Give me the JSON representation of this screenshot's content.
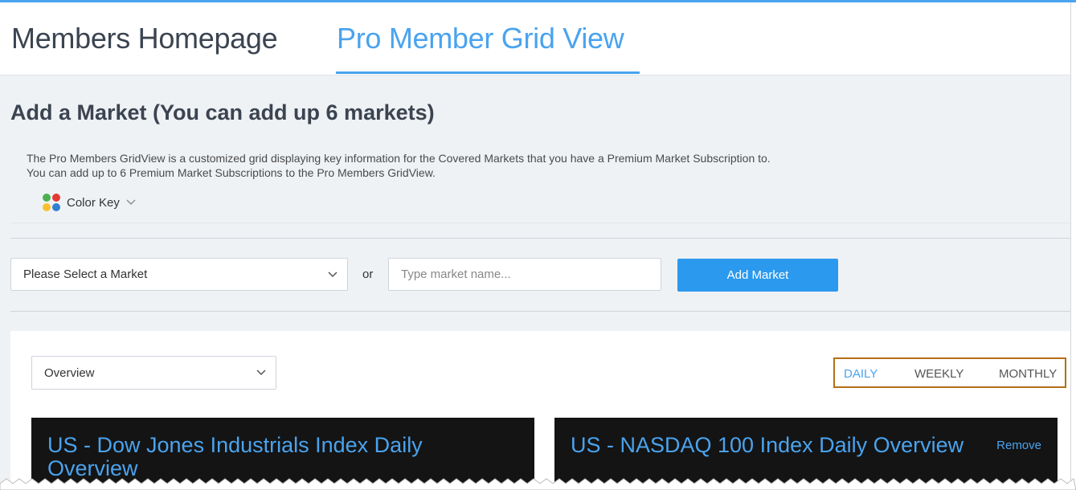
{
  "header": {
    "tabs": [
      {
        "label": "Members Homepage",
        "active": false
      },
      {
        "label": "Pro Member Grid View",
        "active": true
      }
    ]
  },
  "add_market": {
    "title": "Add a Market (You can add up 6 markets)",
    "description_line1": "The Pro Members GridView is a customized grid displaying key information for the Covered Markets that you have a Premium Market Subscription to.",
    "description_line2": "You can add up to 6 Premium Market Subscriptions to the Pro Members GridView.",
    "color_key_label": "Color Key",
    "market_select": {
      "selected": "Please Select a Market"
    },
    "or_label": "or",
    "market_input": {
      "placeholder": "Type market name...",
      "value": ""
    },
    "add_button_label": "Add Market"
  },
  "grid": {
    "view_select": {
      "selected": "Overview"
    },
    "periods": [
      "DAILY",
      "WEEKLY",
      "MONTHLY"
    ],
    "active_period": "DAILY",
    "cards": [
      {
        "title": "US - Dow Jones Industrials Index Daily Overview"
      },
      {
        "title": "US - NASDAQ 100 Index Daily Overview",
        "action_label": "Remove"
      }
    ]
  },
  "colors": {
    "accent": "#4aa3ee",
    "button": "#2b99ee",
    "highlight_border": "#b46e16",
    "card_bg": "#141414",
    "page_bg": "#eff2f5"
  }
}
